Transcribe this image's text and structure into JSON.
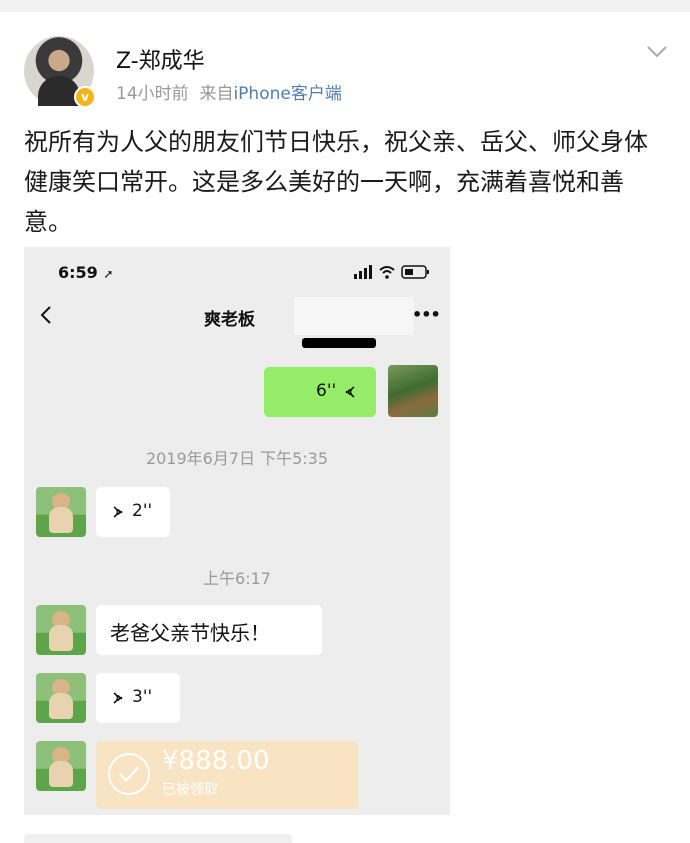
{
  "post": {
    "username": "Z-郑成华",
    "time": "14小时前",
    "source_prefix": "来自",
    "source": "iPhone客户端",
    "text": "祝所有为人父的朋友们节日快乐，祝父亲、岳父、师父身体健康笑口常开。这是多么美好的一天啊，充满着喜悦和善意。",
    "verified_badge": "v"
  },
  "screenshot": {
    "status_time": "6:59",
    "chat_title": "爽老板",
    "more": "•••",
    "messages": [
      {
        "type": "voice",
        "side": "right",
        "length": "6''"
      },
      {
        "type": "timestamp",
        "text": "2019年6月7日 下午5:35"
      },
      {
        "type": "voice",
        "side": "left",
        "length": "2''"
      },
      {
        "type": "timestamp",
        "text": "上午6:17"
      },
      {
        "type": "text",
        "side": "left",
        "text": "老爸父亲节快乐！"
      },
      {
        "type": "voice",
        "side": "left",
        "length": "3''"
      },
      {
        "type": "transfer",
        "side": "left",
        "amount": "¥888.00",
        "status": "已被领取"
      }
    ]
  },
  "icons": {
    "chevron": "chevron-down-icon",
    "back": "back-arrow-icon",
    "signal": "signal-icon",
    "wifi": "wifi-icon",
    "battery": "battery-icon",
    "voice": "voice-wave-icon",
    "check": "check-circle-icon"
  },
  "colors": {
    "link": "#507daf",
    "chat_bg": "#ededed",
    "bubble_green": "#95ec69",
    "transfer_bg": "#f8e3c2",
    "badge": "#f5b31a"
  }
}
